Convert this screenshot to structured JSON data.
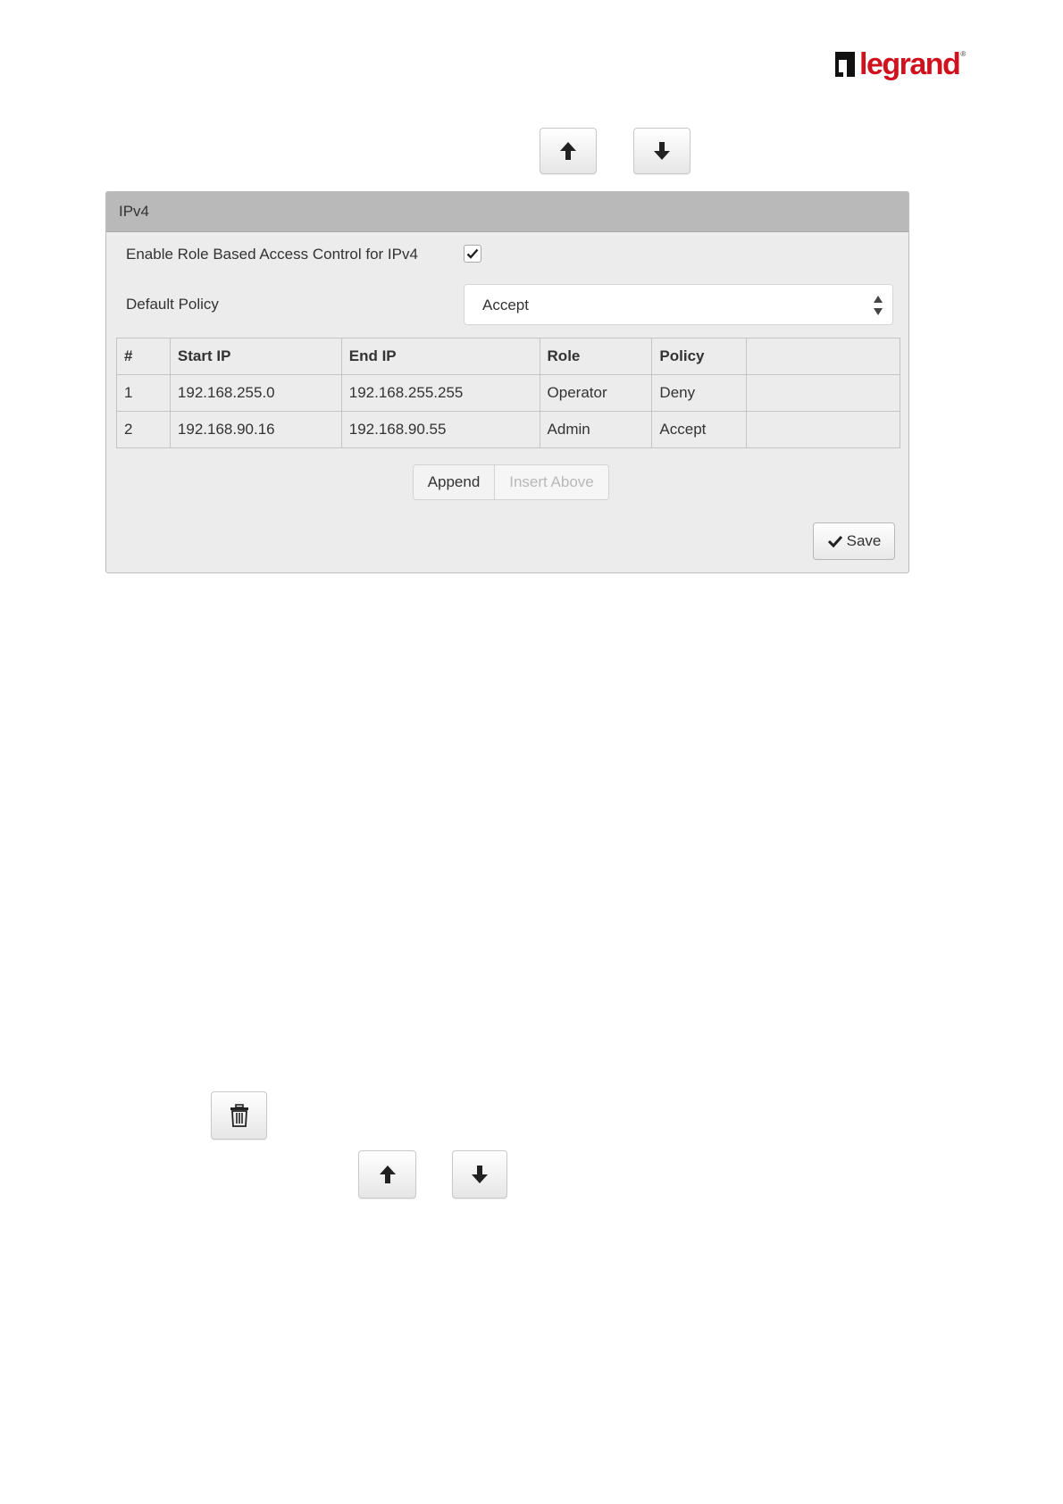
{
  "logo": {
    "text": "legrand",
    "reg": "®"
  },
  "top_buttons": {
    "up_icon": "arrow-up-icon",
    "down_icon": "arrow-down-icon"
  },
  "panel": {
    "title": "IPv4",
    "enable_label": "Enable Role Based Access Control for IPv4",
    "enable_checked": true,
    "default_policy_label": "Default Policy",
    "default_policy_value": "Accept"
  },
  "table": {
    "headers": [
      "#",
      "Start IP",
      "End IP",
      "Role",
      "Policy",
      ""
    ],
    "rows": [
      [
        "1",
        "192.168.255.0",
        "192.168.255.255",
        "Operator",
        "Deny",
        ""
      ],
      [
        "2",
        "192.168.90.16",
        "192.168.90.55",
        "Admin",
        "Accept",
        ""
      ]
    ]
  },
  "actions": {
    "append": "Append",
    "insert_above": "Insert Above",
    "save": "Save"
  },
  "bottom_buttons": {
    "delete_icon": "trash-icon",
    "up_icon": "arrow-up-icon",
    "down_icon": "arrow-down-icon"
  },
  "colors": {
    "brand_red": "#d0121f",
    "panel_header": "#b9b9b9",
    "panel_bg": "#ececec"
  }
}
